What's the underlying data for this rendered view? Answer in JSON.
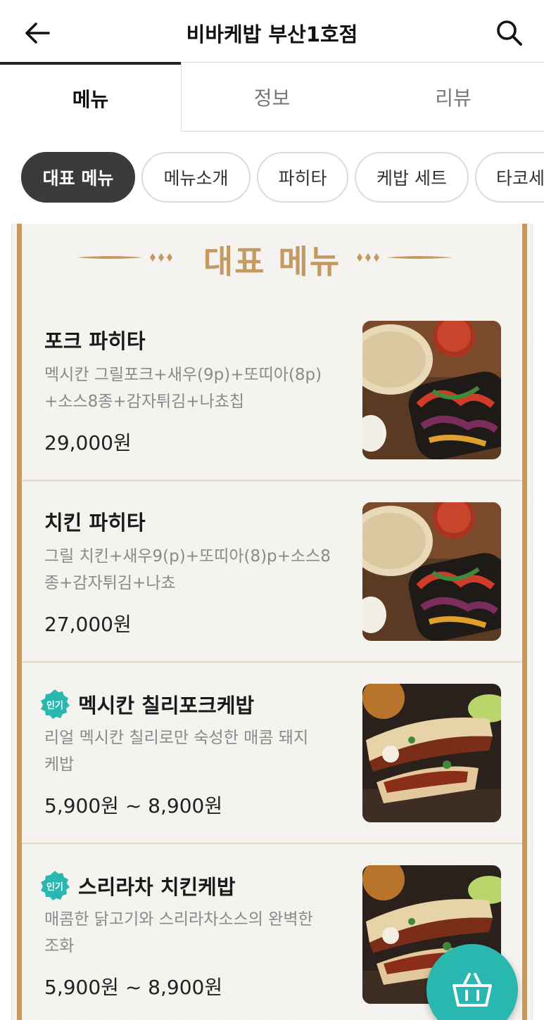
{
  "header": {
    "title": "비바케밥 부산1호점",
    "back_icon": "arrow-left-icon",
    "search_icon": "search-icon"
  },
  "tabs": [
    {
      "label": "메뉴",
      "active": true
    },
    {
      "label": "정보",
      "active": false
    },
    {
      "label": "리뷰",
      "active": false
    }
  ],
  "chips": [
    {
      "label": "대표 메뉴",
      "active": true
    },
    {
      "label": "메뉴소개",
      "active": false
    },
    {
      "label": "파히타",
      "active": false
    },
    {
      "label": "케밥 세트",
      "active": false
    },
    {
      "label": "타코세",
      "active": false
    }
  ],
  "section": {
    "title": "대표 메뉴",
    "accent_color": "#c49a63"
  },
  "items": [
    {
      "name": "포크 파히타",
      "badge": "",
      "desc_lines": [
        "멕시칸 그릴포크+새우(9p)+또띠아(8p)",
        "+소스8종+감자튀김+나쵸칩"
      ],
      "price": "29,000원",
      "image": "fajita-photo"
    },
    {
      "name": "치킨 파히타",
      "badge": "",
      "desc_lines": [
        "그릴 치킨+새우9(p)+또띠아(8)p+소스8",
        "종+감자튀김+나쵸"
      ],
      "price": "27,000원",
      "image": "fajita-photo"
    },
    {
      "name": "멕시칸 칠리포크케밥",
      "badge": "인기",
      "desc_lines": [
        "리얼 멕시칸 칠리로만 숙성한 매콤 돼지",
        "케밥"
      ],
      "price": "5,900원 ~ 8,900원",
      "image": "kebab-wrap-photo"
    },
    {
      "name": "스리라차 치킨케밥",
      "badge": "인기",
      "desc_lines": [
        "매콤한 닭고기와 스리라차소스의 완벽한",
        "조화"
      ],
      "price": "5,900원 ~ 8,900원",
      "image": "kebab-wrap-photo"
    }
  ],
  "cart": {
    "icon": "basket-icon",
    "color": "#29b7b0"
  },
  "colors": {
    "badge": "#29b7b0",
    "chip_active": "#3b3b3b",
    "rail": "#c49a63"
  }
}
